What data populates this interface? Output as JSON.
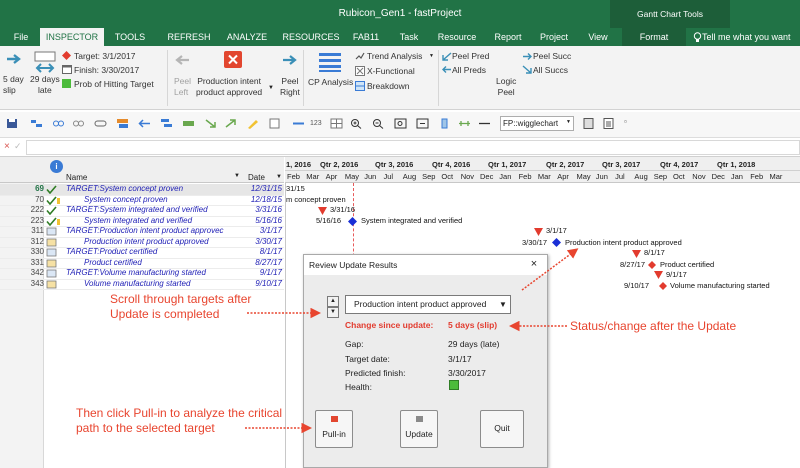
{
  "window": {
    "title": "Rubicon_Gen1  -  fastProject",
    "context_header": "Gantt Chart Tools"
  },
  "tabs": [
    "File",
    "INSPECTOR",
    "TOOLS",
    "REFRESH",
    "ANALYZE",
    "RESOURCES",
    "FAB11",
    "Task",
    "Resource",
    "Report",
    "Project",
    "View"
  ],
  "context_tab": "Format",
  "tell_me": "Tell me what you want",
  "ribbon": {
    "slip_label": "5 day\nslip",
    "late_label": "29 days\nlate",
    "target": "Target: 3/1/2017",
    "finish": "Finish: 3/30/2017",
    "prob": "Prob of Hitting Target",
    "peel_left": "Peel\nLeft",
    "production_intent": "Production intent\nproduct approved",
    "peel_right": "Peel\nRight",
    "cp_analysis": "CP Analysis",
    "trend_analysis": "Trend Analysis",
    "x_functional": "X-Functional",
    "breakdown": "Breakdown",
    "peel_pred": "Peel Pred",
    "all_preds": "All Preds",
    "logic_peel": "Logic\nPeel",
    "peel_succ": "Peel Succ",
    "all_succs": "All Succs"
  },
  "quick_toolbar": {
    "combo_value": "FP::wigglechart",
    "zoom_text": "123"
  },
  "formula_bar": {
    "cancel": "×",
    "confirm": "✓"
  },
  "table": {
    "col_name": "Name",
    "col_date": "Date",
    "rows": [
      {
        "id": "69",
        "name": "TARGET:System concept proven",
        "date": "12/31/15"
      },
      {
        "id": "70",
        "name": "System concept proven",
        "date": "12/18/15"
      },
      {
        "id": "222",
        "name": "TARGET:System integrated and verified",
        "date": "3/31/16"
      },
      {
        "id": "223",
        "name": "System integrated and verified",
        "date": "5/16/16"
      },
      {
        "id": "311",
        "name": "TARGET:Production intent product approvec",
        "date": "3/1/17"
      },
      {
        "id": "312",
        "name": "Production intent product approved",
        "date": "3/30/17"
      },
      {
        "id": "330",
        "name": "TARGET:Product certified",
        "date": "8/1/17"
      },
      {
        "id": "331",
        "name": "Product certified",
        "date": "8/27/17"
      },
      {
        "id": "342",
        "name": "TARGET:Volume manufacturing started",
        "date": "9/1/17"
      },
      {
        "id": "343",
        "name": "Volume manufacturing started",
        "date": "9/10/17"
      }
    ]
  },
  "timescale": {
    "quarters": [
      "1, 2016",
      "Qtr 2, 2016",
      "Qtr 3, 2016",
      "Qtr 4, 2016",
      "Qtr 1, 2017",
      "Qtr 2, 2017",
      "Qtr 3, 2017",
      "Qtr 4, 2017",
      "Qtr 1, 2018"
    ],
    "months": [
      "Feb",
      "Mar",
      "Apr",
      "May",
      "Jun",
      "Jul",
      "Aug",
      "Sep",
      "Oct",
      "Nov",
      "Dec",
      "Jan",
      "Feb",
      "Mar",
      "Apr",
      "May",
      "Jun",
      "Jul",
      "Aug",
      "Sep",
      "Oct",
      "Nov",
      "Dec",
      "Jan",
      "Feb",
      "Mar"
    ]
  },
  "gantt_labels": {
    "r69": "31/15",
    "r70": "m concept proven",
    "r222": "3/31/16",
    "r223_date": "5/16/16",
    "r223_name": "System integrated and verified",
    "r311": "3/1/17",
    "r312_date": "3/30/17",
    "r312_name": "Production intent product approved",
    "r330": "8/1/17",
    "r331_date": "8/27/17",
    "r331_name": "Product certified",
    "r342": "9/1/17",
    "r343_date": "9/10/17",
    "r343_name": "Volume manufacturing started"
  },
  "dialog": {
    "title": "Review Update Results",
    "close": "×",
    "selected_target": "Production intent product approved",
    "change_label": "Change since update:",
    "change_value": "5 days (slip)",
    "gap_label": "Gap:",
    "gap_value": "29 days (late)",
    "target_label": "Target date:",
    "target_value": "3/1/17",
    "predicted_label": "Predicted finish:",
    "predicted_value": "3/30/2017",
    "health_label": "Health:",
    "btn_pullin": "Pull-in",
    "btn_update": "Update",
    "btn_quit": "Quit"
  },
  "callouts": {
    "scroll": "Scroll through targets after\nUpdate is completed",
    "status": "Status/change after the Update",
    "pullin": "Then click Pull-in to analyze the critical\npath to the selected target"
  },
  "colors": {
    "ribbon_green": "#217346",
    "callout_red": "#e8452f",
    "task_blue": "#1d1db5",
    "milestone_blue": "#1a2fd6",
    "target_red": "#e23b2e",
    "health_green": "#4cbb3b"
  }
}
